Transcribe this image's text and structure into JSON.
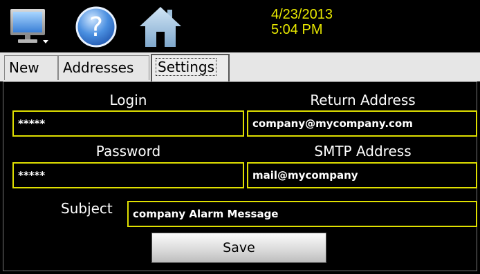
{
  "header": {
    "date": "4/23/2013",
    "time": "5:04 PM",
    "icons": [
      "monitor-icon",
      "help-icon",
      "home-icon"
    ],
    "datetime_color": "#e8e800"
  },
  "tabs": [
    {
      "label": "New"
    },
    {
      "label": "Addresses"
    },
    {
      "label": "Settings",
      "active": true
    }
  ],
  "form": {
    "login_label": "Login",
    "login_value": "*****",
    "return_address_label": "Return Address",
    "return_address_value": "company@mycompany.com",
    "password_label": "Password",
    "password_value": "*****",
    "smtp_label": "SMTP Address",
    "smtp_value": "mail@mycompany",
    "subject_label": "Subject",
    "subject_value": "company Alarm Message",
    "save_label": "Save",
    "field_border_color": "#e0e000"
  }
}
